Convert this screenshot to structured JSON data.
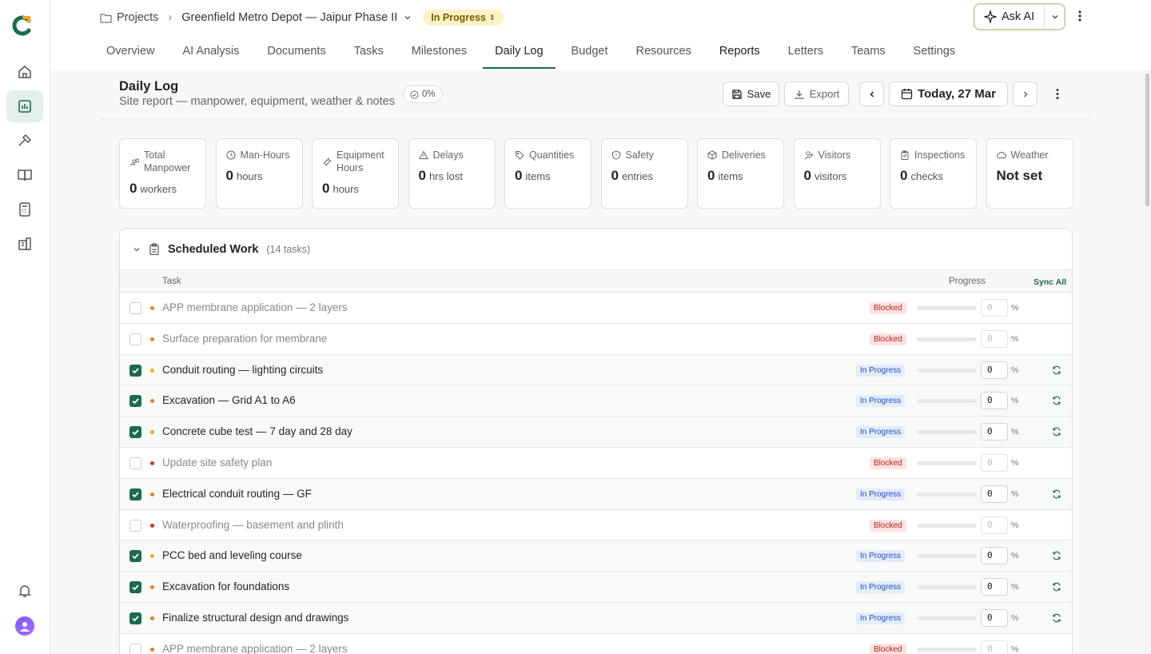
{
  "breadcrumb": {
    "root": "Projects",
    "project": "Greenfield Metro Depot — Jaipur Phase II",
    "status": "In Progress"
  },
  "header": {
    "ask_ai": "Ask AI"
  },
  "tabs": [
    {
      "label": "Overview"
    },
    {
      "label": "AI Analysis"
    },
    {
      "label": "Documents"
    },
    {
      "label": "Tasks"
    },
    {
      "label": "Milestones"
    },
    {
      "label": "Daily Log"
    },
    {
      "label": "Budget"
    },
    {
      "label": "Resources"
    },
    {
      "label": "Reports"
    },
    {
      "label": "Letters"
    },
    {
      "label": "Teams"
    },
    {
      "label": "Settings"
    }
  ],
  "page": {
    "title": "Daily Log",
    "subtitle": "Site report — manpower, equipment, weather & notes",
    "completion": "0%",
    "save": "Save",
    "export": "Export",
    "date": "Today, 27 Mar"
  },
  "stats": [
    {
      "label": "Total Manpower",
      "value": "0",
      "unit": "workers",
      "icon": "users-icon"
    },
    {
      "label": "Man-Hours",
      "value": "0",
      "unit": "hours",
      "icon": "clock-icon"
    },
    {
      "label": "Equipment Hours",
      "value": "0",
      "unit": "hours",
      "icon": "wrench-icon"
    },
    {
      "label": "Delays",
      "value": "0",
      "unit": "hrs lost",
      "icon": "warning-icon"
    },
    {
      "label": "Quantities",
      "value": "0",
      "unit": "items",
      "icon": "tag-icon"
    },
    {
      "label": "Safety",
      "value": "0",
      "unit": "entries",
      "icon": "shield-icon"
    },
    {
      "label": "Deliveries",
      "value": "0",
      "unit": "items",
      "icon": "package-icon"
    },
    {
      "label": "Visitors",
      "value": "0",
      "unit": "visitors",
      "icon": "user-plus-icon"
    },
    {
      "label": "Inspections",
      "value": "0",
      "unit": "checks",
      "icon": "clipboard-icon"
    },
    {
      "label": "Weather",
      "value": "Not set",
      "unit": "",
      "icon": "cloud-icon"
    }
  ],
  "scheduled": {
    "title": "Scheduled Work",
    "count": "(14 tasks)",
    "col_task": "Task",
    "col_progress": "Progress",
    "sync_all": "Sync All",
    "pct_sign": "%",
    "rows": [
      {
        "name": "APP membrane application — 2 layers",
        "status": "Blocked",
        "checked": false,
        "dot": "#f07b1d",
        "progress": "0",
        "fraction": 0
      },
      {
        "name": "Surface preparation for membrane",
        "status": "Blocked",
        "checked": false,
        "dot": "#f07b1d",
        "progress": "0",
        "fraction": 0
      },
      {
        "name": "Conduit routing — lighting circuits",
        "status": "In Progress",
        "checked": true,
        "dot": "#f0a81d",
        "progress": "0",
        "fraction": 0
      },
      {
        "name": "Excavation — Grid A1 to A6",
        "status": "In Progress",
        "checked": true,
        "dot": "#f07b1d",
        "progress": "0",
        "fraction": 0
      },
      {
        "name": "Concrete cube test — 7 day and 28 day",
        "status": "In Progress",
        "checked": true,
        "dot": "#f0a81d",
        "progress": "0",
        "fraction": 0
      },
      {
        "name": "Update site safety plan",
        "status": "Blocked",
        "checked": false,
        "dot": "#d92d20",
        "progress": "0",
        "fraction": 0
      },
      {
        "name": "Electrical conduit routing — GF",
        "status": "In Progress",
        "checked": true,
        "dot": "#f07b1d",
        "progress": "0",
        "fraction": 0
      },
      {
        "name": "Waterproofing — basement and plinth",
        "status": "Blocked",
        "checked": false,
        "dot": "#d92d20",
        "progress": "0",
        "fraction": 0
      },
      {
        "name": "PCC bed and leveling course",
        "status": "In Progress",
        "checked": true,
        "dot": "#f0a81d",
        "progress": "0",
        "fraction": 0
      },
      {
        "name": "Excavation for foundations",
        "status": "In Progress",
        "checked": true,
        "dot": "#f07b1d",
        "progress": "0",
        "fraction": 0
      },
      {
        "name": "Finalize structural design and drawings",
        "status": "In Progress",
        "checked": true,
        "dot": "#f07b1d",
        "progress": "0",
        "fraction": 0
      },
      {
        "name": "APP membrane application — 2 layers",
        "status": "Blocked",
        "checked": false,
        "dot": "#f07b1d",
        "progress": "0",
        "fraction": 0
      }
    ]
  }
}
